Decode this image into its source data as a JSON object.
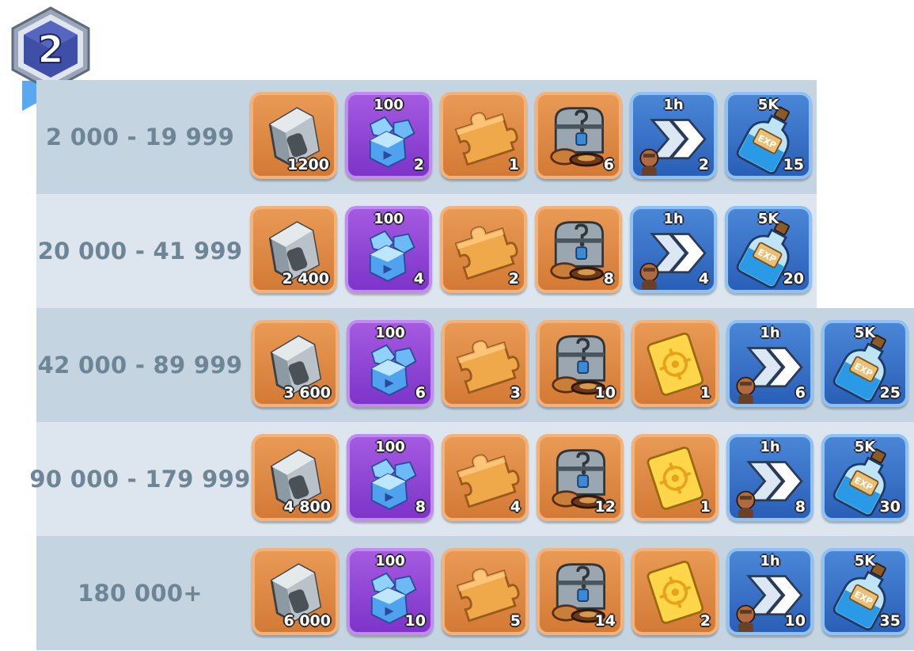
{
  "rank_badge": {
    "number": "2"
  },
  "tiers": [
    {
      "range": "2 000 - 19 999",
      "rewards": [
        {
          "item": "ammo",
          "qty": "1200"
        },
        {
          "item": "gems",
          "top": "100",
          "qty": "2"
        },
        {
          "item": "puzzle-piece",
          "qty": "1"
        },
        {
          "item": "mystery-chest",
          "qty": "6"
        },
        {
          "item": "speedup",
          "top": "1h",
          "qty": "2"
        },
        {
          "item": "exp-potion",
          "top": "5K",
          "qty": "15"
        }
      ]
    },
    {
      "range": "20 000 - 41 999",
      "rewards": [
        {
          "item": "ammo",
          "qty": "2 400"
        },
        {
          "item": "gems",
          "top": "100",
          "qty": "4"
        },
        {
          "item": "puzzle-piece",
          "qty": "2"
        },
        {
          "item": "mystery-chest",
          "qty": "8"
        },
        {
          "item": "speedup",
          "top": "1h",
          "qty": "4"
        },
        {
          "item": "exp-potion",
          "top": "5K",
          "qty": "20"
        }
      ]
    },
    {
      "range": "42 000 - 89 999",
      "rewards": [
        {
          "item": "ammo",
          "qty": "3 600"
        },
        {
          "item": "gems",
          "top": "100",
          "qty": "6"
        },
        {
          "item": "puzzle-piece",
          "qty": "3"
        },
        {
          "item": "mystery-chest",
          "qty": "10"
        },
        {
          "item": "target-ticket",
          "qty": "1"
        },
        {
          "item": "speedup",
          "top": "1h",
          "qty": "6"
        },
        {
          "item": "exp-potion",
          "top": "5K",
          "qty": "25"
        }
      ]
    },
    {
      "range": "90 000 - 179 999",
      "rewards": [
        {
          "item": "ammo",
          "qty": "4 800"
        },
        {
          "item": "gems",
          "top": "100",
          "qty": "8"
        },
        {
          "item": "puzzle-piece",
          "qty": "4"
        },
        {
          "item": "mystery-chest",
          "qty": "12"
        },
        {
          "item": "target-ticket",
          "qty": "1"
        },
        {
          "item": "speedup",
          "top": "1h",
          "qty": "8"
        },
        {
          "item": "exp-potion",
          "top": "5K",
          "qty": "30"
        }
      ]
    },
    {
      "range": "180 000+",
      "rewards": [
        {
          "item": "ammo",
          "qty": "6 000"
        },
        {
          "item": "gems",
          "top": "100",
          "qty": "10"
        },
        {
          "item": "puzzle-piece",
          "qty": "5"
        },
        {
          "item": "mystery-chest",
          "qty": "14"
        },
        {
          "item": "target-ticket",
          "qty": "2"
        },
        {
          "item": "speedup",
          "top": "1h",
          "qty": "10"
        },
        {
          "item": "exp-potion",
          "top": "5K",
          "qty": "35"
        }
      ]
    }
  ],
  "exp_label": "EXP",
  "colors": {
    "orange": "#d27a36",
    "purple": "#7d34c8",
    "blue": "#2a5fb8",
    "row_dark": "#c5d4e1",
    "row_light": "#dde6ee",
    "range_text": "#6e8596"
  }
}
